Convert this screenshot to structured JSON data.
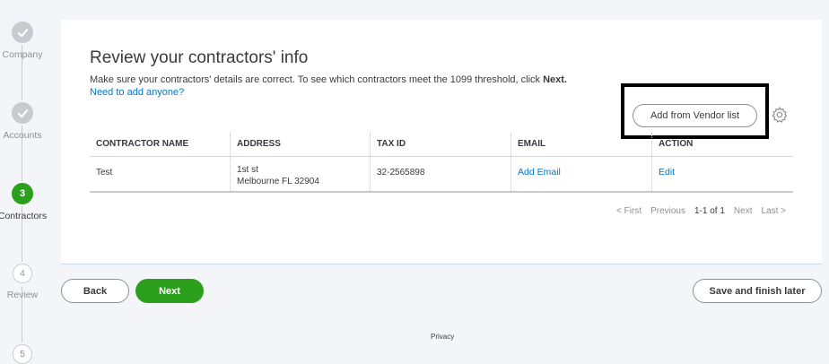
{
  "stepper": {
    "steps": [
      {
        "label": "Company",
        "number": "1",
        "state": "done"
      },
      {
        "label": "Accounts",
        "number": "2",
        "state": "done"
      },
      {
        "label": "Contractors",
        "number": "3",
        "state": "current"
      },
      {
        "label": "Review",
        "number": "4",
        "state": "future"
      },
      {
        "label": "",
        "number": "5",
        "state": "future"
      }
    ]
  },
  "page": {
    "title": "Review your contractors' info",
    "subtitle_text": "Make sure your contractors' details are correct. To see which contractors meet the 1099 threshold, click ",
    "subtitle_bold": "Next.",
    "need_link": "Need to add anyone?",
    "vendor_button": "Add from Vendor list",
    "gear_icon": "gear-icon"
  },
  "table": {
    "headers": [
      "CONTRACTOR NAME",
      "ADDRESS",
      "TAX ID",
      "EMAIL",
      "ACTION"
    ],
    "rows": [
      {
        "name": "Test",
        "address_line1": "1st st",
        "address_line2": "Melbourne FL 32904",
        "tax_id": "32-2565898",
        "email_action": "Add Email",
        "action": "Edit"
      }
    ]
  },
  "pager": {
    "first": "< First",
    "previous": "Previous",
    "range": "1-1 of 1",
    "next": "Next",
    "last": "Last >"
  },
  "footer": {
    "back": "Back",
    "next": "Next",
    "save": "Save and finish later",
    "privacy": "Privacy"
  },
  "colors": {
    "accent_green": "#2ca01c",
    "link_blue": "#0077c5",
    "step_gray": "#c8cacf"
  }
}
